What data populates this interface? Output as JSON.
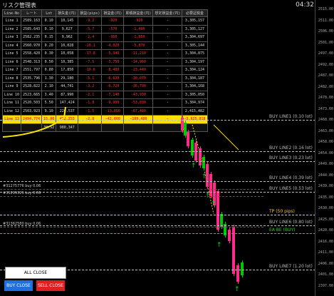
{
  "window": {
    "title": "リスク管理表",
    "clock": "04:32"
  },
  "table": {
    "headers": [
      "Line-No",
      "レート",
      "Lot",
      "損失金(円)",
      "損益(pips)",
      "損益金(円)",
      "累積損益金(円)",
      "想定損益金(円)",
      "必要証拠金"
    ],
    "rows": [
      {
        "cells": [
          "Line 1",
          "2589.163",
          "0.10",
          "10,145",
          "-9.2",
          "-920",
          "-920",
          "-",
          "3,305,157"
        ]
      },
      {
        "cells": [
          "Line 2",
          "2585.643",
          "0.10",
          "9,627",
          "-5.7",
          "-570",
          "-1,490",
          "-",
          "3,305,127"
        ]
      },
      {
        "cells": [
          "Line 3",
          "2582.235",
          "0.15",
          "9,962",
          "-2.4",
          "-360",
          "-1,850",
          "-",
          "3,304,697"
        ]
      },
      {
        "cells": [
          "Line 4",
          "2560.970",
          "0.20",
          "10,028",
          "-20.1",
          "-4,020",
          "-5,870",
          "-",
          "3,305,144"
        ]
      },
      {
        "cells": [
          "Line 5",
          "2558.420",
          "0.30",
          "10,058",
          "-17.8",
          "-5,340",
          "-11,210",
          "-",
          "3,304,875"
        ]
      },
      {
        "cells": [
          "Line 6",
          "2548.313",
          "0.50",
          "10,385",
          "-7.5",
          "-3,750",
          "-14,960",
          "-",
          "3,304,197"
        ]
      },
      {
        "cells": [
          "Line 7",
          "2551.797",
          "0.80",
          "17,850",
          "-10.6",
          "-8,480",
          "-23,440",
          "-",
          "3,304,124"
        ]
      },
      {
        "cells": [
          "Line 8",
          "2535.796",
          "1.30",
          "29,180",
          "-5.1",
          "-6,630",
          "-30,070",
          "-",
          "3,304,187"
        ]
      },
      {
        "cells": [
          "Line 9",
          "2528.822",
          "2.10",
          "44,741",
          "-3.2",
          "-6,720",
          "-36,790",
          "-",
          "3,304,168"
        ]
      },
      {
        "cells": [
          "Line 10",
          "2523.665",
          "3.40",
          "87,990",
          "-2.1",
          "-7,140",
          "-43,930",
          "-",
          "3,305,050"
        ]
      },
      {
        "cells": [
          "Line 11",
          "2520.503",
          "5.50",
          "147,424",
          "-1.8",
          "-9,900",
          "-53,830",
          "-",
          "3,304,974"
        ]
      },
      {
        "cells": [
          "Line 12",
          "2503.923",
          "9.10",
          "220,537",
          "-1.5",
          "-13,650",
          "-67,480",
          "-",
          "2,415,482"
        ]
      },
      {
        "cells": [
          "Line 13",
          "2494.774",
          "15.00",
          "452,253",
          "-2.8",
          "-42,000",
          "-109,480",
          "-",
          "-3,025,818"
        ],
        "highlight": true
      },
      {
        "cells": [
          "",
          "",
          "38.52",
          "980,347",
          "",
          "",
          "",
          "",
          ""
        ],
        "summary": true
      }
    ]
  },
  "chart": {
    "levels": [
      {
        "label": "BUY LINE1 (0.10 lot)",
        "color": "#bbbbbb"
      },
      {
        "label": "BUY LINE2 (0.16 lot)",
        "color": "#bbbbbb"
      },
      {
        "label": "BUY LINE3 (0.23 lot)",
        "color": "#bbbbbb"
      },
      {
        "label": "BUY LINE4 (0.39 lot)",
        "color": "#bbbbbb"
      },
      {
        "label": "BUY LINE5 (0.53 lot)",
        "color": "#bbbbbb"
      },
      {
        "label": "TP (50 pips)",
        "color": "#ffcc00"
      },
      {
        "label": "BUY LINE6 (0.80 lot)",
        "color": "#bbbbbb"
      },
      {
        "label": "EA BE (BUY)",
        "color": "#00ee00"
      },
      {
        "label": "BUY LINE7 (1.20 lot)",
        "color": "#bbbbbb"
      }
    ],
    "tags": [
      "#31275776 buy 0.06",
      "#31299321 buy 0.06",
      "#31362580 buy 0.06"
    ],
    "axis_ticks": [
      "2515.00",
      "2511.00",
      "2506.00",
      "2501.00",
      "2497.00",
      "2492.00",
      "2487.00",
      "2482.00",
      "2478.00",
      "2473.00",
      "2468.00",
      "2463.00",
      "2458.00",
      "2454.00",
      "2449.00",
      "2444.00",
      "2439.00",
      "2435.00",
      "2430.00",
      "2425.00",
      "2420.00",
      "2416.00",
      "2411.00",
      "2406.00",
      "2401.00",
      "2397.00"
    ],
    "up_color": "#00c800",
    "down_color": "#ff2a8a"
  },
  "buttons": {
    "all_close": "ALL CLOSE",
    "buy_close": "BUY CLOSE",
    "sell_close": "SELL CLOSE"
  }
}
